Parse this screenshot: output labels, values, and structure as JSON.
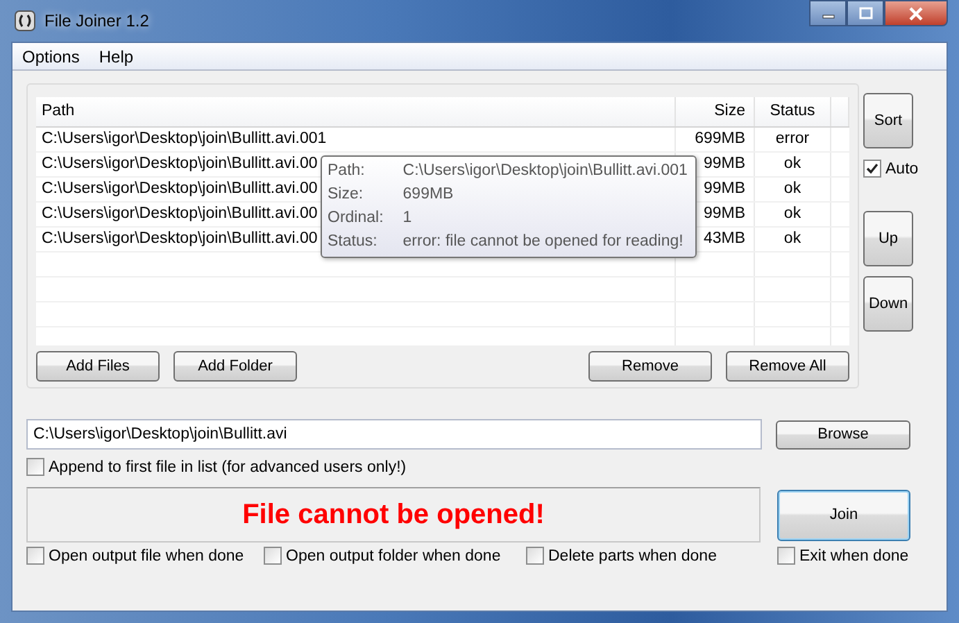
{
  "window": {
    "title": "File Joiner 1.2"
  },
  "menu": [
    "Options",
    "Help"
  ],
  "table": {
    "columns": [
      "Path",
      "Size",
      "Status"
    ],
    "rows": [
      {
        "path": "C:\\Users\\igor\\Desktop\\join\\Bullitt.avi.001",
        "size": "699MB",
        "status": "error"
      },
      {
        "path": "C:\\Users\\igor\\Desktop\\join\\Bullitt.avi.00",
        "size": "99MB",
        "status": "ok"
      },
      {
        "path": "C:\\Users\\igor\\Desktop\\join\\Bullitt.avi.00",
        "size": "99MB",
        "status": "ok"
      },
      {
        "path": "C:\\Users\\igor\\Desktop\\join\\Bullitt.avi.00",
        "size": "99MB",
        "status": "ok"
      },
      {
        "path": "C:\\Users\\igor\\Desktop\\join\\Bullitt.avi.00",
        "size": "43MB",
        "status": "ok"
      }
    ]
  },
  "tooltip": [
    {
      "label": "Path:",
      "value": "C:\\Users\\igor\\Desktop\\join\\Bullitt.avi.001"
    },
    {
      "label": "Size:",
      "value": "699MB"
    },
    {
      "label": "Ordinal:",
      "value": "1"
    },
    {
      "label": "Status:",
      "value": "error: file cannot be opened for reading!"
    }
  ],
  "sort_button": "Sort",
  "auto": {
    "label": "Auto",
    "checked": true
  },
  "move_buttons": [
    "Up",
    "Down"
  ],
  "list_buttons_left": [
    "Add Files",
    "Add Folder"
  ],
  "list_buttons_right": [
    "Remove",
    "Remove All"
  ],
  "output": {
    "value": "C:\\Users\\igor\\Desktop\\join\\Bullitt.avi",
    "browse": "Browse"
  },
  "append": {
    "label": "Append to first file in list (for advanced users only!)",
    "checked": false
  },
  "message": "File cannot be opened!",
  "join_button": "Join",
  "options": [
    {
      "label": "Open output file when done",
      "checked": false
    },
    {
      "label": "Open output folder when done",
      "checked": false
    },
    {
      "label": "Delete parts when done",
      "checked": false
    },
    {
      "label": "Exit when done",
      "checked": false
    }
  ]
}
